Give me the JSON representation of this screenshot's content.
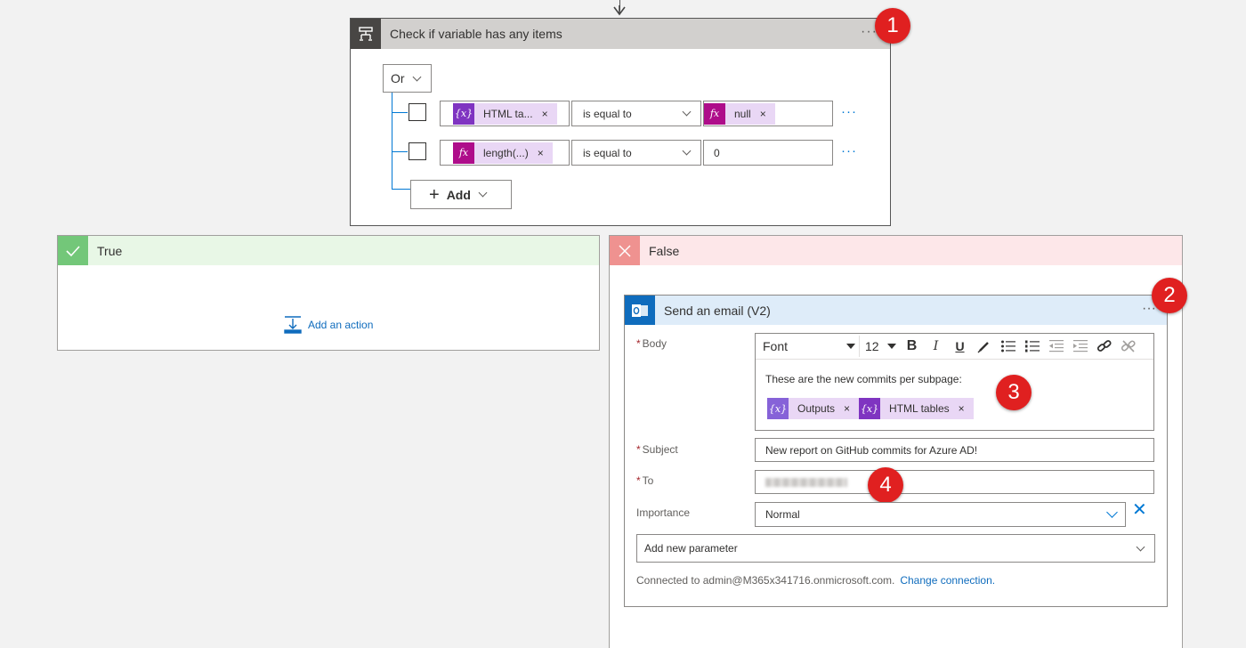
{
  "condition": {
    "title": "Check if variable has any items",
    "more": "···",
    "or_label": "Or",
    "rows": [
      {
        "token_icon": "{x}",
        "token_label": "HTML ta...",
        "remove": "×",
        "operator": "is equal to",
        "value_token_icon": "fx",
        "value_token_label": "null",
        "value_remove": "×",
        "more": "···"
      },
      {
        "token_icon": "fx",
        "token_label": "length(...)",
        "remove": "×",
        "operator": "is equal to",
        "value": "0",
        "more": "···"
      }
    ],
    "add_label": "Add",
    "add_plus": "+"
  },
  "badges": [
    "1",
    "2",
    "3",
    "4"
  ],
  "true_branch": {
    "title": "True",
    "add_action": "Add an action"
  },
  "false_branch": {
    "title": "False"
  },
  "email": {
    "title": "Send an email (V2)",
    "more": "···",
    "body_label": "Body",
    "required_mark": "*",
    "toolbar": {
      "font": "Font",
      "size": "12",
      "bold": "B",
      "italic": "I",
      "underline": "U"
    },
    "body_text": "These are the new commits per subpage:",
    "body_tokens": [
      {
        "icon": "{x}",
        "label": "Outputs",
        "remove": "×"
      },
      {
        "icon": "{x}",
        "label": "HTML tables",
        "remove": "×"
      }
    ],
    "subject_label": "Subject",
    "subject_value": "New report on GitHub commits for Azure AD!",
    "to_label": "To",
    "importance_label": "Importance",
    "importance_value": "Normal",
    "importance_clear": "✕",
    "add_param": "Add new parameter",
    "connected_text": "Connected to admin@M365x341716.onmicrosoft.com.",
    "change_connection": "Change connection."
  }
}
